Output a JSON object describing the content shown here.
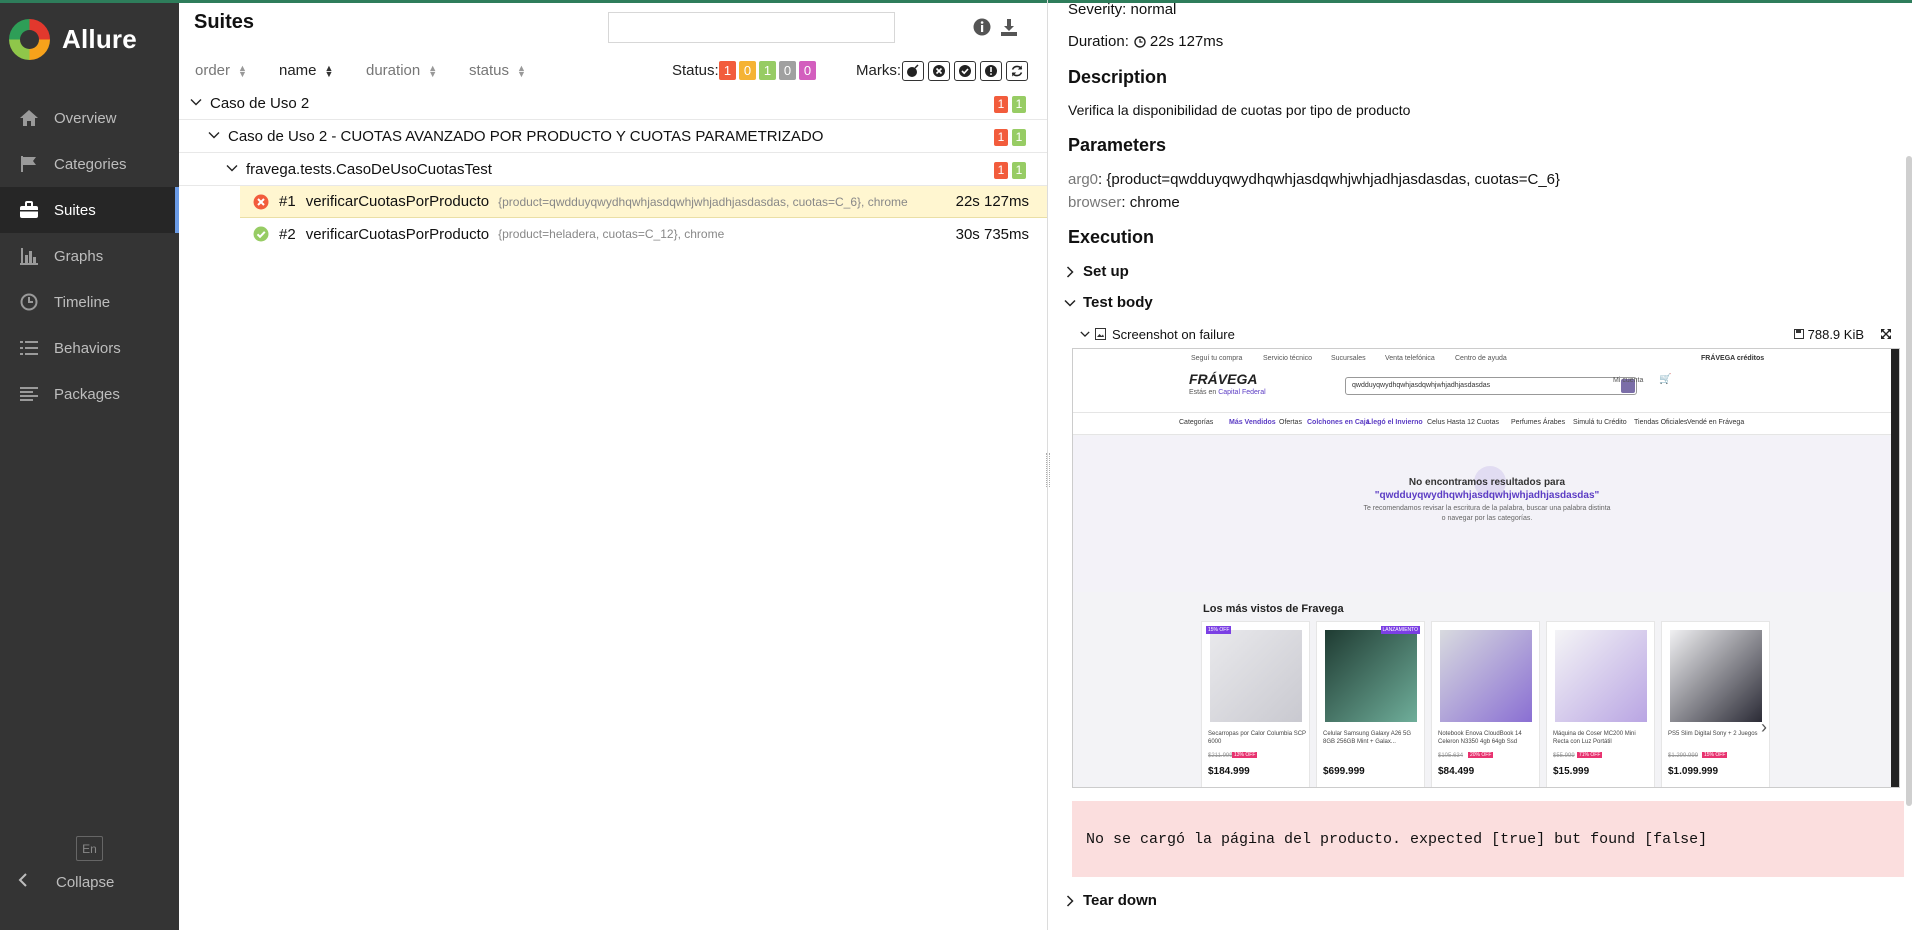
{
  "app": {
    "name": "Allure",
    "language": "En",
    "collapse_label": "Collapse"
  },
  "sidebar": {
    "items": [
      {
        "label": "Overview",
        "icon": "home-icon",
        "active": false
      },
      {
        "label": "Categories",
        "icon": "flag-icon",
        "active": false
      },
      {
        "label": "Suites",
        "icon": "briefcase-icon",
        "active": true
      },
      {
        "label": "Graphs",
        "icon": "bar-chart-icon",
        "active": false
      },
      {
        "label": "Timeline",
        "icon": "clock-icon",
        "active": false
      },
      {
        "label": "Behaviors",
        "icon": "list-icon",
        "active": false
      },
      {
        "label": "Packages",
        "icon": "align-left-icon",
        "active": false
      }
    ]
  },
  "suites": {
    "title": "Suites",
    "search_value": "",
    "sort": {
      "order": "order",
      "name": "name",
      "duration": "duration",
      "status": "status"
    },
    "status_label": "Status:",
    "status_counts": [
      {
        "value": "1",
        "color": "#f25c3c"
      },
      {
        "value": "0",
        "color": "#f5b334"
      },
      {
        "value": "1",
        "color": "#97cc64"
      },
      {
        "value": "0",
        "color": "#a0a0a0"
      },
      {
        "value": "0",
        "color": "#d35ebe"
      }
    ],
    "marks_label": "Marks:",
    "tree": {
      "level1": {
        "label": "Caso de Uso 2",
        "failed": "1",
        "passed": "1"
      },
      "level2": {
        "label": "Caso de Uso 2 - CUOTAS AVANZADO POR PRODUCTO Y CUOTAS PARAMETRIZADO",
        "failed": "1",
        "passed": "1"
      },
      "level3": {
        "label": "fravega.tests.CasoDeUsoCuotasTest",
        "failed": "1",
        "passed": "1"
      },
      "cases": [
        {
          "num": "#1",
          "name": "verificarCuotasPorProducto",
          "params": "{product=qwdduyqwydhqwhjasdqwhjwhjadhjasdasdas, cuotas=C_6}, chrome",
          "duration": "22s 127ms",
          "status": "failed"
        },
        {
          "num": "#2",
          "name": "verificarCuotasPorProducto",
          "params": "{product=heladera, cuotas=C_12}, chrome",
          "duration": "30s 735ms",
          "status": "passed"
        }
      ]
    }
  },
  "details": {
    "severity": "Severity: normal",
    "duration_label": "Duration:",
    "duration_value": "22s 127ms",
    "description_heading": "Description",
    "description_text": "Verifica la disponibilidad de cuotas por tipo de producto",
    "parameters_heading": "Parameters",
    "param1_key": "arg0",
    "param1_value": "{product=qwdduyqwydhqwhjasdqwhjwhjadhjasdasdas, cuotas=C_6}",
    "param2_key": "browser",
    "param2_value": "chrome",
    "execution_heading": "Execution",
    "setup_label": "Set up",
    "testbody_label": "Test body",
    "attachment_name": "Screenshot on failure",
    "attachment_size": "788.9 KiB",
    "error_message": "No se cargó la página del producto. expected [true] but found [false]",
    "teardown_label": "Tear down"
  },
  "screenshot": {
    "util_links": [
      "Seguí tu compra",
      "Servicio técnico",
      "Sucursales",
      "Venta telefónica",
      "Centro de ayuda"
    ],
    "creditos": "FRÁVEGA créditos",
    "brand": "FRÁVEGA",
    "location_prefix": "Estás en",
    "location": "Capital Federal",
    "search_value": "qwdduyqwydhqwhjasdqwhjwhjadhjasdasdas",
    "account": "Mi cuenta",
    "menu": [
      "Categorías",
      "Más Vendidos",
      "Ofertas",
      "Colchones en Caja",
      "Llegó el Invierno",
      "Celus Hasta 12 Cuotas",
      "Perfumes Árabes",
      "Simulá tu Crédito",
      "Tiendas Oficiales",
      "Vendé en Frávega"
    ],
    "no_results": "No encontramos resultados para",
    "no_results_query": "\"qwdduyqwydhqwhjasdqwhjwhjadhjasdasdas\"",
    "no_results_hint": "Te recomendamos revisar la escritura de la palabra, buscar una palabra distinta o navegar por las categorías.",
    "products_title": "Los más vistos de Fravega",
    "products": [
      {
        "name": "Secarropas por Calor Columbia SCP 6000",
        "old": "$211.999",
        "off": "13% OFF",
        "price": "$184.999",
        "tag": "15% OFF"
      },
      {
        "name": "Celular Samsung Galaxy A26 5G 8GB 256GB Mint + Galax...",
        "old": "",
        "off": "",
        "price": "$699.999",
        "tag": "LANZAMIENTO"
      },
      {
        "name": "Notebook Enova CloudBook 14 Celeron N3350 4gb 64gb Ssd",
        "old": "$105.634",
        "off": "20% OFF",
        "price": "$84.499",
        "tag": ""
      },
      {
        "name": "Máquina de Coser MC200 Mini Recta con Luz Portátil",
        "old": "$55.999",
        "off": "71% OFF",
        "price": "$15.999",
        "tag": ""
      },
      {
        "name": "PS5 Slim Digital Sony + 2 Juegos",
        "old": "$1.299.999",
        "off": "15% OFF",
        "price": "$1.099.999",
        "tag": ""
      }
    ]
  }
}
